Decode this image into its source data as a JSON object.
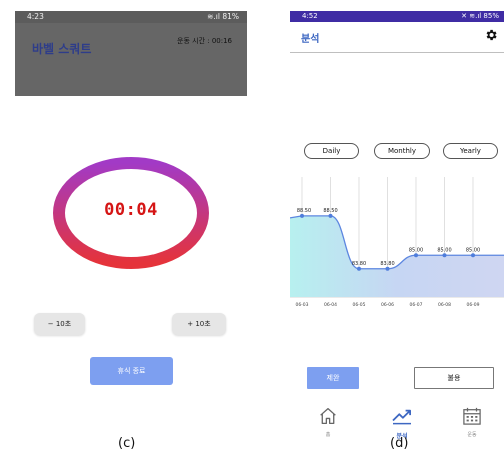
{
  "panel_c": {
    "status": {
      "time": "4:23",
      "signal": "≋.ıl 81%"
    },
    "title": "바벨 스쿼트",
    "elapsed": "운동 시간 : 00:16",
    "timer": "00:04",
    "minus_btn": "− 10초",
    "plus_btn": "+ 10초",
    "end_btn": "휴식 종료",
    "caption": "(c)",
    "colors": {
      "ring_start": "#a23ac6",
      "ring_end": "#e5333a",
      "timer": "#d51515",
      "accent_btn": "#7d9ff0"
    }
  },
  "panel_d": {
    "status": {
      "time": "4:52",
      "signal": "✕ ≋.ıl 85%"
    },
    "title": "분석",
    "pills": [
      "Daily",
      "Monthly",
      "Yearly"
    ],
    "btn_done": "제완",
    "btn_fail": "불용",
    "nav": {
      "home": {
        "icon": "home-icon",
        "label": "홈"
      },
      "analysis": {
        "icon": "trend-chart-icon",
        "label": "분석"
      },
      "calendar": {
        "icon": "calendar-icon",
        "label": "운동"
      }
    },
    "caption": "(d)",
    "colors": {
      "accent": "#3d67c2",
      "status_bar": "#3f2ca4",
      "line": "#5c86e0"
    }
  },
  "chart_data": {
    "type": "area",
    "x": [
      "06-03",
      "06-04",
      "06-05",
      "06-06",
      "06-07",
      "06-08",
      "06-09"
    ],
    "series": [
      {
        "values": [
          88.5,
          88.5,
          83.8,
          83.8,
          85.0,
          85.0,
          85.0
        ],
        "labels": [
          "88.50",
          "88.50",
          "83.80",
          "83.80",
          "85.00",
          "85.00",
          "85.00"
        ]
      }
    ],
    "grid": "vertical lines",
    "ylim": [
      82.0,
      90.0
    ]
  }
}
